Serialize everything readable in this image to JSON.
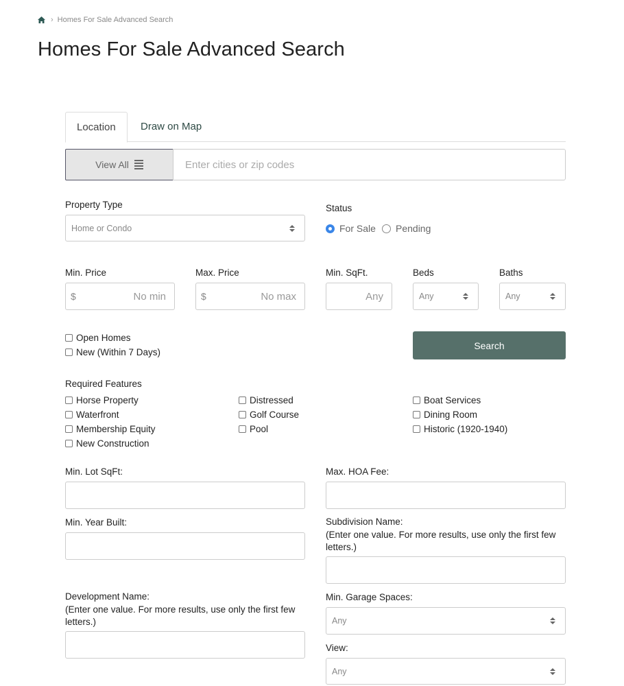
{
  "breadcrumb": {
    "home_icon": "home-icon",
    "current": "Homes For Sale Advanced Search"
  },
  "page_title": "Homes For Sale Advanced Search",
  "tabs": [
    {
      "label": "Location",
      "active": true
    },
    {
      "label": "Draw on Map",
      "active": false
    }
  ],
  "location": {
    "view_all_label": "View All",
    "view_all_icon": "list-icon",
    "search_placeholder": "Enter cities or zip codes"
  },
  "property_type": {
    "label": "Property Type",
    "value": "Home or Condo"
  },
  "status": {
    "label": "Status",
    "options": [
      {
        "label": "For Sale",
        "checked": true
      },
      {
        "label": "Pending",
        "checked": false
      }
    ]
  },
  "min_price": {
    "label": "Min. Price",
    "currency": "$",
    "placeholder": "No min"
  },
  "max_price": {
    "label": "Max. Price",
    "currency": "$",
    "placeholder": "No max"
  },
  "min_sqft": {
    "label": "Min. SqFt.",
    "placeholder": "Any"
  },
  "beds": {
    "label": "Beds",
    "value": "Any"
  },
  "baths": {
    "label": "Baths",
    "value": "Any"
  },
  "filters": [
    {
      "label": "Open Homes",
      "checked": false
    },
    {
      "label": "New (Within 7 Days)",
      "checked": false
    }
  ],
  "search_button": "Search",
  "required_features": {
    "label": "Required Features",
    "col1": [
      "Horse Property",
      "Waterfront",
      "Membership Equity",
      "New Construction"
    ],
    "col2": [
      "Distressed",
      "Golf Course",
      "Pool"
    ],
    "col3": [
      "Boat Services",
      "Dining Room",
      "Historic (1920-1940)"
    ]
  },
  "min_lot_sqft": {
    "label": "Min. Lot SqFt:",
    "value": ""
  },
  "max_hoa_fee": {
    "label": "Max. HOA Fee:",
    "value": ""
  },
  "min_year_built": {
    "label": "Min. Year Built:",
    "value": ""
  },
  "subdivision_name": {
    "label": "Subdivision Name:",
    "hint": "(Enter one value. For more results, use only the first few letters.)",
    "value": ""
  },
  "development_name": {
    "label": "Development Name:",
    "hint": "(Enter one value. For more results, use only the first few letters.)",
    "value": ""
  },
  "min_garage_spaces": {
    "label": "Min. Garage Spaces:",
    "value": "Any"
  },
  "view": {
    "label": "View:",
    "value": "Any"
  }
}
